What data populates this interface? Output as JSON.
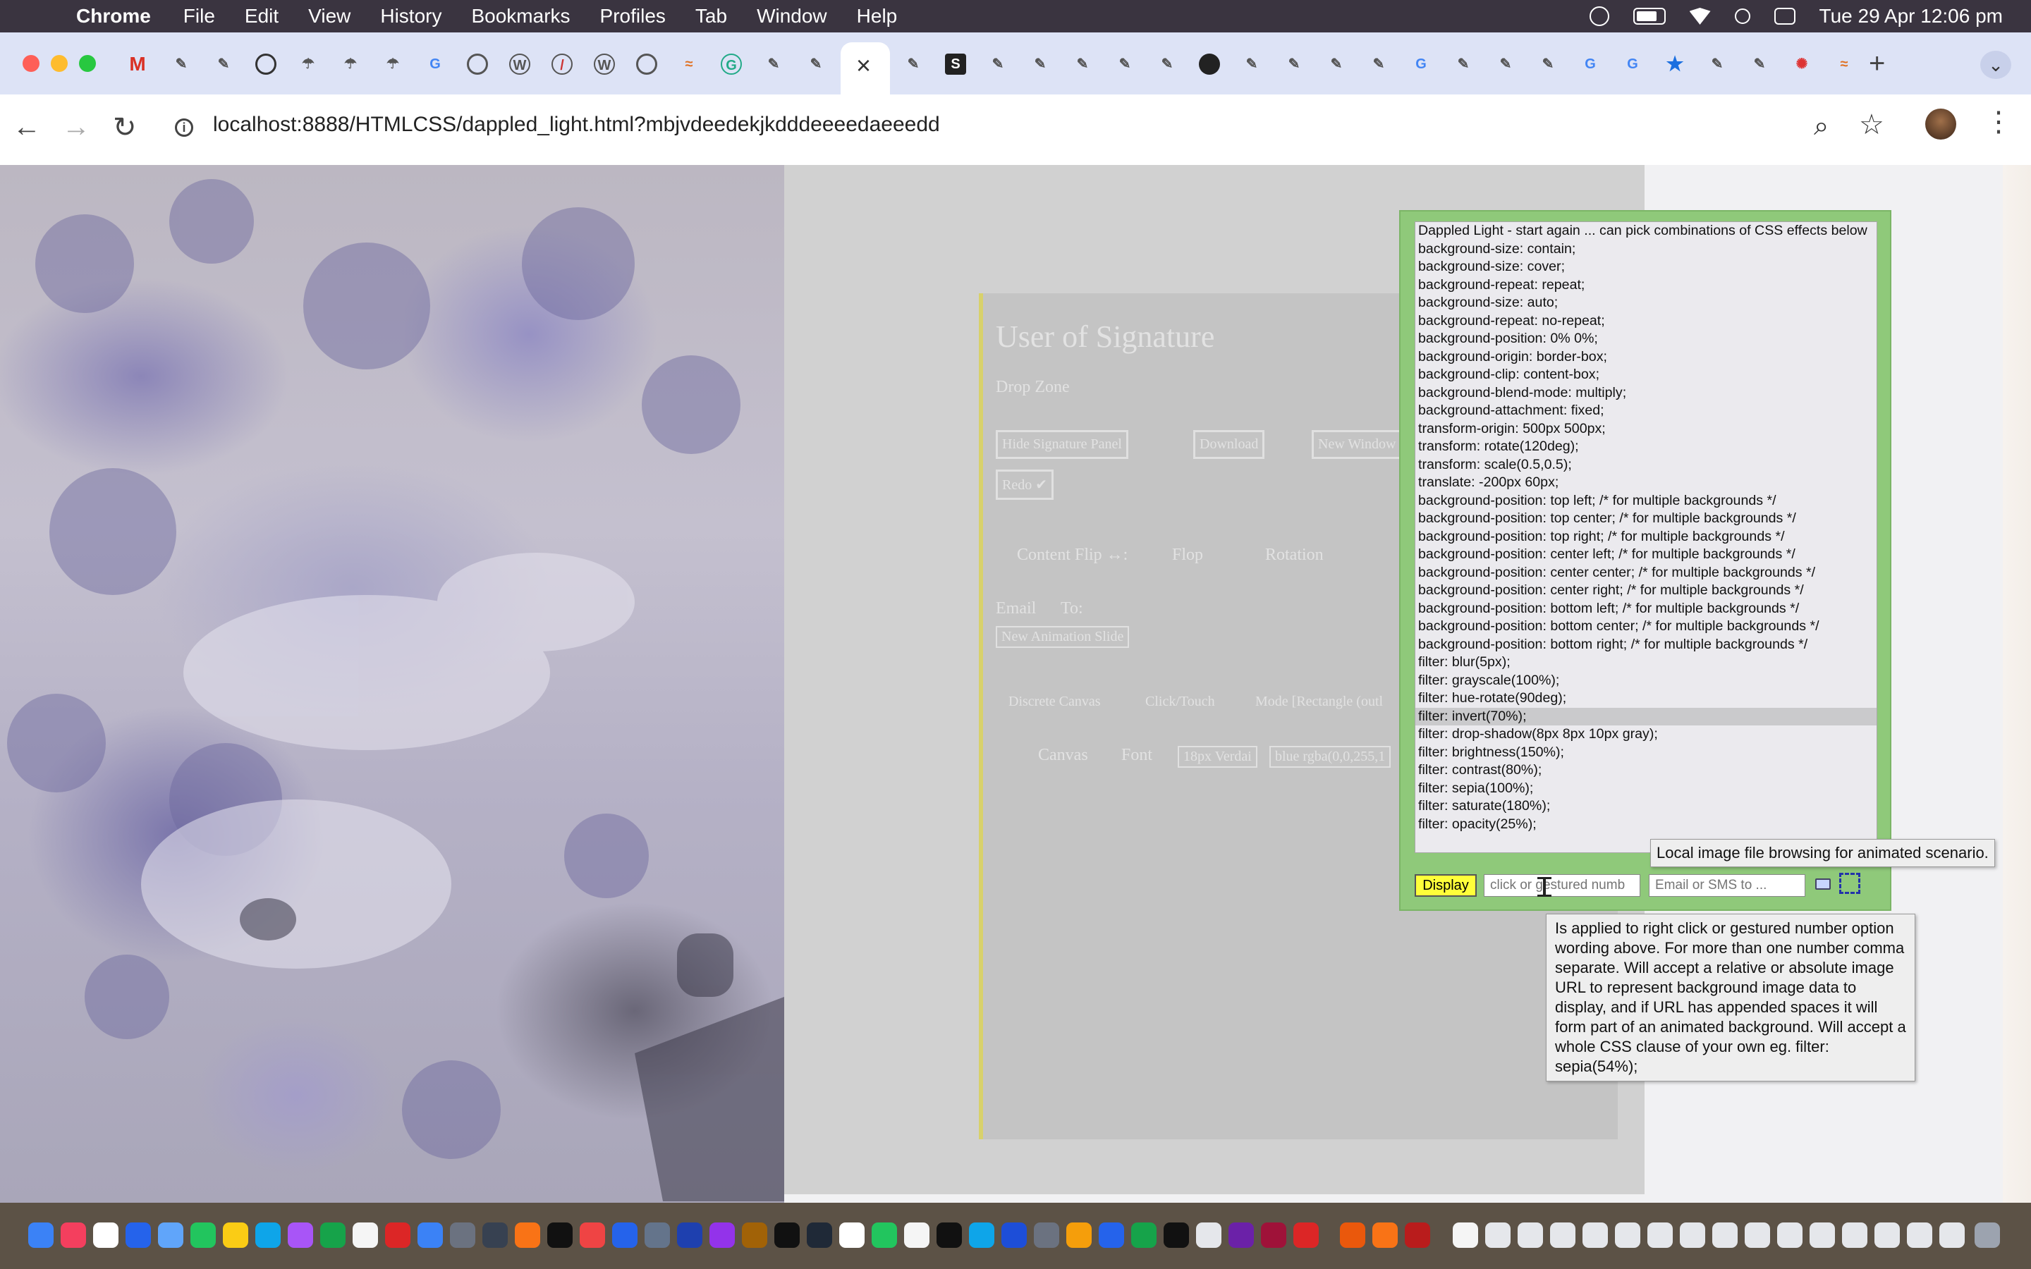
{
  "menubar": {
    "app_name": "Chrome",
    "menus": [
      "File",
      "Edit",
      "View",
      "History",
      "Bookmarks",
      "Profiles",
      "Tab",
      "Window",
      "Help"
    ],
    "clock": "Tue 29 Apr  12:06 pm"
  },
  "browser": {
    "url": "localhost:8888/HTMLCSS/dappled_light.html?mbjvdeedekjkdddeeeedaeeedd",
    "active_tab_close": "×",
    "new_tab": "+"
  },
  "ghost_page": {
    "title": "User of Signature",
    "drop_zone": "Drop Zone",
    "hide_button": "Hide Signature Panel",
    "download_button": "Download",
    "new_window_button": "New Window",
    "redo_button": "Redo ✔",
    "content_flip": "Content Flip ↔:",
    "flop": "Flop",
    "rotation": "Rotation",
    "email": "Email",
    "to": "To:",
    "new_animation_slide": "New Animation Slide",
    "discrete_canvas": "Discrete Canvas",
    "click_touch": "Click/Touch",
    "mode": "Mode [Rectangle (outl",
    "canvas": "Canvas",
    "font": "Font",
    "font_value": "18px Verdai",
    "color_value": "blue rgba(0,0,255,1"
  },
  "effects_panel": {
    "options": [
      "Dappled Light - start again ... can pick combinations of CSS effects below",
      "background-size: contain;",
      "background-size: cover;",
      "background-repeat: repeat;",
      "background-size: auto;",
      "background-repeat: no-repeat;",
      "background-position: 0% 0%;",
      "background-origin: border-box;",
      "background-clip: content-box;",
      "background-blend-mode: multiply;",
      "background-attachment: fixed;",
      "transform-origin: 500px 500px;",
      "transform: rotate(120deg);",
      "transform: scale(0.5,0.5);",
      "translate: -200px 60px;",
      "background-position: top left; /* for multiple backgrounds */",
      "background-position: top center; /* for multiple backgrounds */",
      "background-position: top right; /* for multiple backgrounds */",
      "background-position: center left; /* for multiple backgrounds */",
      "background-position: center center; /* for multiple backgrounds */",
      "background-position: center right; /* for multiple backgrounds */",
      "background-position: bottom left; /* for multiple backgrounds */",
      "background-position: bottom center; /* for multiple backgrounds */",
      "background-position: bottom right; /* for multiple backgrounds */",
      "filter: blur(5px);",
      "filter: grayscale(100%);",
      "filter: hue-rotate(90deg);",
      "filter: invert(70%);",
      "filter: drop-shadow(8px 8px 10px gray);",
      "filter: brightness(150%);",
      "filter: contrast(80%);",
      "filter: sepia(100%);",
      "filter: saturate(180%);",
      "filter: opacity(25%);"
    ],
    "selected_index": 27,
    "display_button": "Display",
    "number_input_placeholder": "click or gestured numb",
    "email_input_placeholder": "Email or SMS to ..."
  },
  "tooltips": {
    "browse": "Local image file browsing for animated scenario.",
    "input": "Is applied to right click or gestured number option wording above.  For more than one number comma separate.  Will accept a relative or absolute image URL to represent background image data to display, and if URL has appended spaces it will form part of an animated background.  Will accept a whole CSS clause of your own eg. filter: sepia(54%);"
  },
  "colors": {
    "panel_green": "#8fc97a",
    "display_yellow": "#ffff3a"
  }
}
